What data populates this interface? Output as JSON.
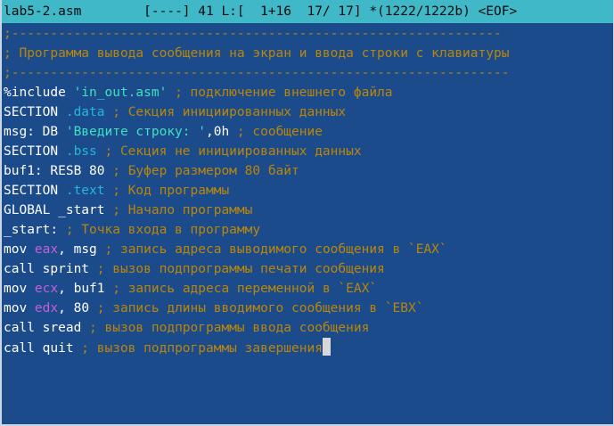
{
  "status_bar": {
    "filename": "lab5-2.asm",
    "info": "        [----] 41 L:[  1+16  17/ 17] *(1222/1222b) <EOF>"
  },
  "lines": [
    [
      {
        "t": ";---------------------------------------------------------------",
        "c": "comment"
      }
    ],
    [
      {
        "t": "; Программа вывода сообщения на экран и ввода строки с клавиатуры",
        "c": "comment"
      }
    ],
    [
      {
        "t": ";----------------------------------------------------------------",
        "c": "comment"
      }
    ],
    [
      {
        "t": "%include ",
        "c": "text"
      },
      {
        "t": "'in_out.asm'",
        "c": "string"
      },
      {
        "t": " ; подключение внешнего файла",
        "c": "comment"
      }
    ],
    [
      {
        "t": "SECTION ",
        "c": "text"
      },
      {
        "t": ".data",
        "c": "section"
      },
      {
        "t": " ; Секция инициированных данных",
        "c": "comment"
      }
    ],
    [
      {
        "t": "msg: DB ",
        "c": "text"
      },
      {
        "t": "'Введите строку: '",
        "c": "string"
      },
      {
        "t": ",0h",
        "c": "text"
      },
      {
        "t": " ; сообщение",
        "c": "comment"
      }
    ],
    [
      {
        "t": "SECTION ",
        "c": "text"
      },
      {
        "t": ".bss",
        "c": "section"
      },
      {
        "t": " ; Секция не инициированных данных",
        "c": "comment"
      }
    ],
    [
      {
        "t": "buf1: RESB 80",
        "c": "text"
      },
      {
        "t": " ; Буфер размером 80 байт",
        "c": "comment"
      }
    ],
    [
      {
        "t": "SECTION ",
        "c": "text"
      },
      {
        "t": ".text",
        "c": "section"
      },
      {
        "t": " ; Код программы",
        "c": "comment"
      }
    ],
    [
      {
        "t": "GLOBAL _start",
        "c": "text"
      },
      {
        "t": " ; Начало программы",
        "c": "comment"
      }
    ],
    [
      {
        "t": "_start:",
        "c": "text"
      },
      {
        "t": " ; Точка входа в программу",
        "c": "comment"
      }
    ],
    [
      {
        "t": "mov ",
        "c": "text"
      },
      {
        "t": "eax",
        "c": "register"
      },
      {
        "t": ", msg",
        "c": "text"
      },
      {
        "t": " ; запись адреса выводимого сообщения в `EAX`",
        "c": "comment"
      }
    ],
    [
      {
        "t": "call sprint",
        "c": "text"
      },
      {
        "t": " ; вызов подпрограммы печати сообщения",
        "c": "comment"
      }
    ],
    [
      {
        "t": "mov ",
        "c": "text"
      },
      {
        "t": "ecx",
        "c": "register"
      },
      {
        "t": ", buf1",
        "c": "text"
      },
      {
        "t": " ; запись адреса переменной в `EAX`",
        "c": "comment"
      }
    ],
    [
      {
        "t": "mov ",
        "c": "text"
      },
      {
        "t": "edx",
        "c": "register"
      },
      {
        "t": ", 80",
        "c": "text"
      },
      {
        "t": " ; запись длины вводимого сообщения в `EBX`",
        "c": "comment"
      }
    ],
    [
      {
        "t": "call sread",
        "c": "text"
      },
      {
        "t": " ; вызов подпрограммы ввода сообщения",
        "c": "comment"
      }
    ],
    [
      {
        "t": "call quit",
        "c": "text"
      },
      {
        "t": " ; вызов подпрограммы завершения",
        "c": "comment"
      }
    ]
  ],
  "cursor_line": 16,
  "colors": {
    "background": "#1c4b8c",
    "status_bar": "#40b8c8",
    "comment": "#b8860b",
    "string": "#3fe0c0",
    "section": "#26b6d4",
    "register": "#c060d8",
    "text": "#ffffff"
  }
}
